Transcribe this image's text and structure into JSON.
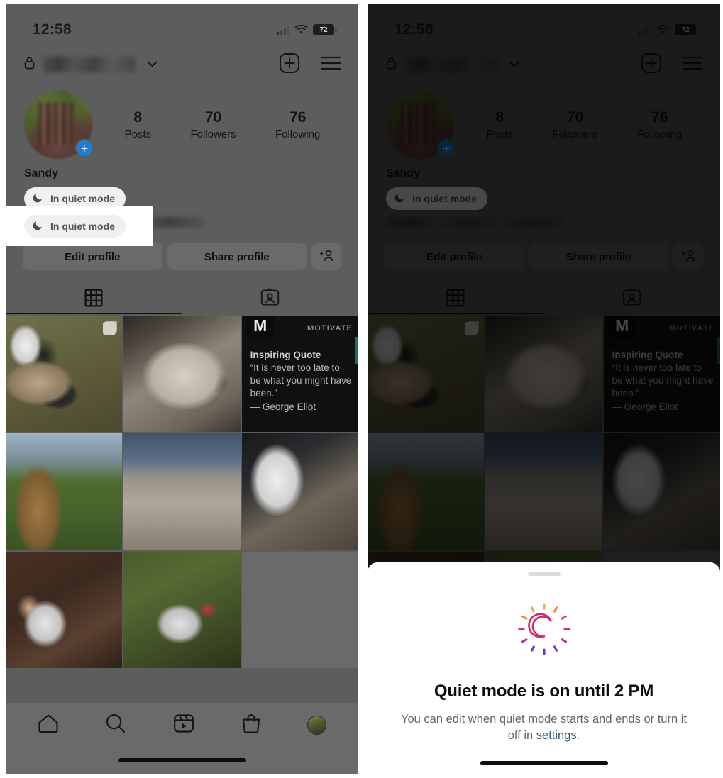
{
  "status_bar": {
    "time": "12:58",
    "battery_level": "72",
    "signal_icon": "cellular-bars-icon",
    "wifi_icon": "wifi-icon",
    "battery_icon": "battery-icon"
  },
  "app_header": {
    "lock_icon": "lock-icon",
    "username_redacted": "",
    "chevron_icon": "chevron-down-icon",
    "create_icon": "plus-square-icon",
    "menu_icon": "hamburger-menu-icon"
  },
  "profile": {
    "display_name": "Sandy",
    "avatar_name": "profile-avatar",
    "add_story_label": "+",
    "stats": [
      {
        "num": "8",
        "label": "Posts"
      },
      {
        "num": "70",
        "label": "Followers"
      },
      {
        "num": "76",
        "label": "Following"
      }
    ],
    "quiet_badge": {
      "label": "In quiet mode",
      "icon": "crescent-moon-icon"
    },
    "buttons": {
      "edit_profile": "Edit profile",
      "share_profile": "Share profile",
      "add_person_icon": "add-person-icon"
    },
    "tabs": [
      {
        "name": "grid-tab",
        "icon": "grid-icon",
        "active": true
      },
      {
        "name": "tagged-tab",
        "icon": "tagged-person-icon",
        "active": false
      }
    ]
  },
  "grid": {
    "cells": [
      {
        "name": "post-dogs-field",
        "style": "ph-dogs1",
        "multi": true
      },
      {
        "name": "post-dog-sleeping",
        "style": "ph-dog-sleep",
        "multi": false
      },
      {
        "name": "post-inspiring-quote",
        "style": "ph-quote",
        "multi": false
      },
      {
        "name": "post-giraffe",
        "style": "ph-giraffe",
        "multi": false
      },
      {
        "name": "post-beach",
        "style": "ph-beach",
        "multi": false
      },
      {
        "name": "post-dog-bed",
        "style": "ph-dog-bed",
        "multi": false
      },
      {
        "name": "post-dog-floor",
        "style": "ph-dog-floor",
        "multi": false
      },
      {
        "name": "post-dog-couch",
        "style": "ph-dog-couch",
        "multi": false
      },
      {
        "name": "post-empty",
        "style": "empty",
        "multi": false
      }
    ],
    "quote_post": {
      "badge_letter": "M",
      "tag": "MOTIVATE",
      "title": "Inspiring Quote",
      "text": "“It is never too late to be what you might have been.”",
      "author": "— George Eliot",
      "accent_color": "#1f6f5a"
    }
  },
  "bottom_nav": {
    "items": [
      {
        "name": "nav-home",
        "icon": "home-icon"
      },
      {
        "name": "nav-search",
        "icon": "search-icon"
      },
      {
        "name": "nav-reels",
        "icon": "reels-icon"
      },
      {
        "name": "nav-shop",
        "icon": "shopping-bag-icon"
      },
      {
        "name": "nav-profile",
        "icon": "avatar-icon"
      }
    ]
  },
  "sheet": {
    "handle_name": "sheet-drag-handle",
    "icon": "quiet-mode-moon-icon",
    "title": "Quiet mode is on until 2 PM",
    "description_before": "You can edit when quiet mode starts and ends or turn it off in ",
    "link_text": "settings",
    "description_after": ".",
    "link_color": "#2f5b79"
  },
  "colors": {
    "left_panel_bg": "#5d5d5d",
    "right_panel_bg": "#141414",
    "highlight_box": "#ffffff",
    "accent_blue": "#1c7ed6",
    "sheet_bg": "#ffffff"
  }
}
